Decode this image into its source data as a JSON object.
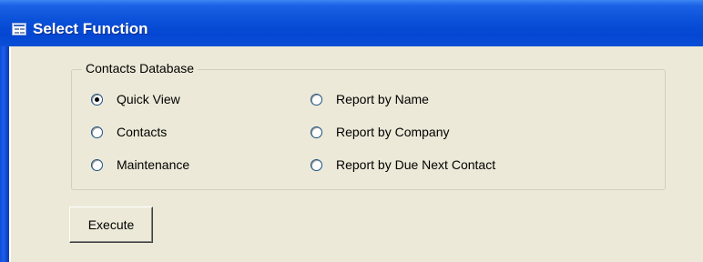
{
  "window": {
    "title": "Select Function",
    "icon": "form-window-icon"
  },
  "group": {
    "label": "Contacts Database",
    "options": [
      {
        "label": "Quick View",
        "selected": true
      },
      {
        "label": "Contacts",
        "selected": false
      },
      {
        "label": "Maintenance",
        "selected": false
      },
      {
        "label": "Report by Name",
        "selected": false
      },
      {
        "label": "Report by Company",
        "selected": false
      },
      {
        "label": "Report by Due Next Contact",
        "selected": false
      }
    ]
  },
  "execute_button": {
    "label": "Execute"
  },
  "colors": {
    "titlebar": "#0A50D8",
    "face": "#ECE9D8",
    "title_text": "#FFFFFF"
  }
}
